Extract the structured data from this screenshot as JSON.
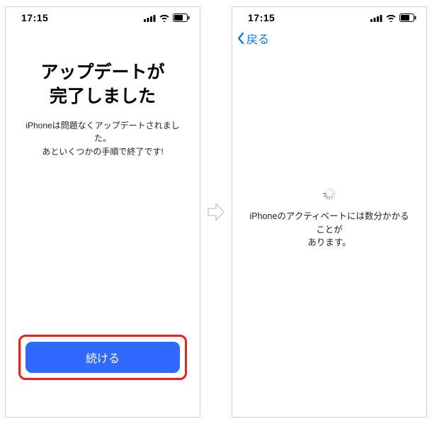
{
  "left_screen": {
    "status_bar": {
      "time": "17:15"
    },
    "title": "アップデートが完了しました",
    "description_line1": "iPhoneは問題なくアップデートされました。",
    "description_line2": "あといくつかの手順で終了です!",
    "continue_button": "続ける"
  },
  "right_screen": {
    "status_bar": {
      "time": "17:15"
    },
    "back_label": "戻る",
    "activation_message_line1": "iPhoneのアクティベートには数分かかることが",
    "activation_message_line2": "あります。"
  }
}
